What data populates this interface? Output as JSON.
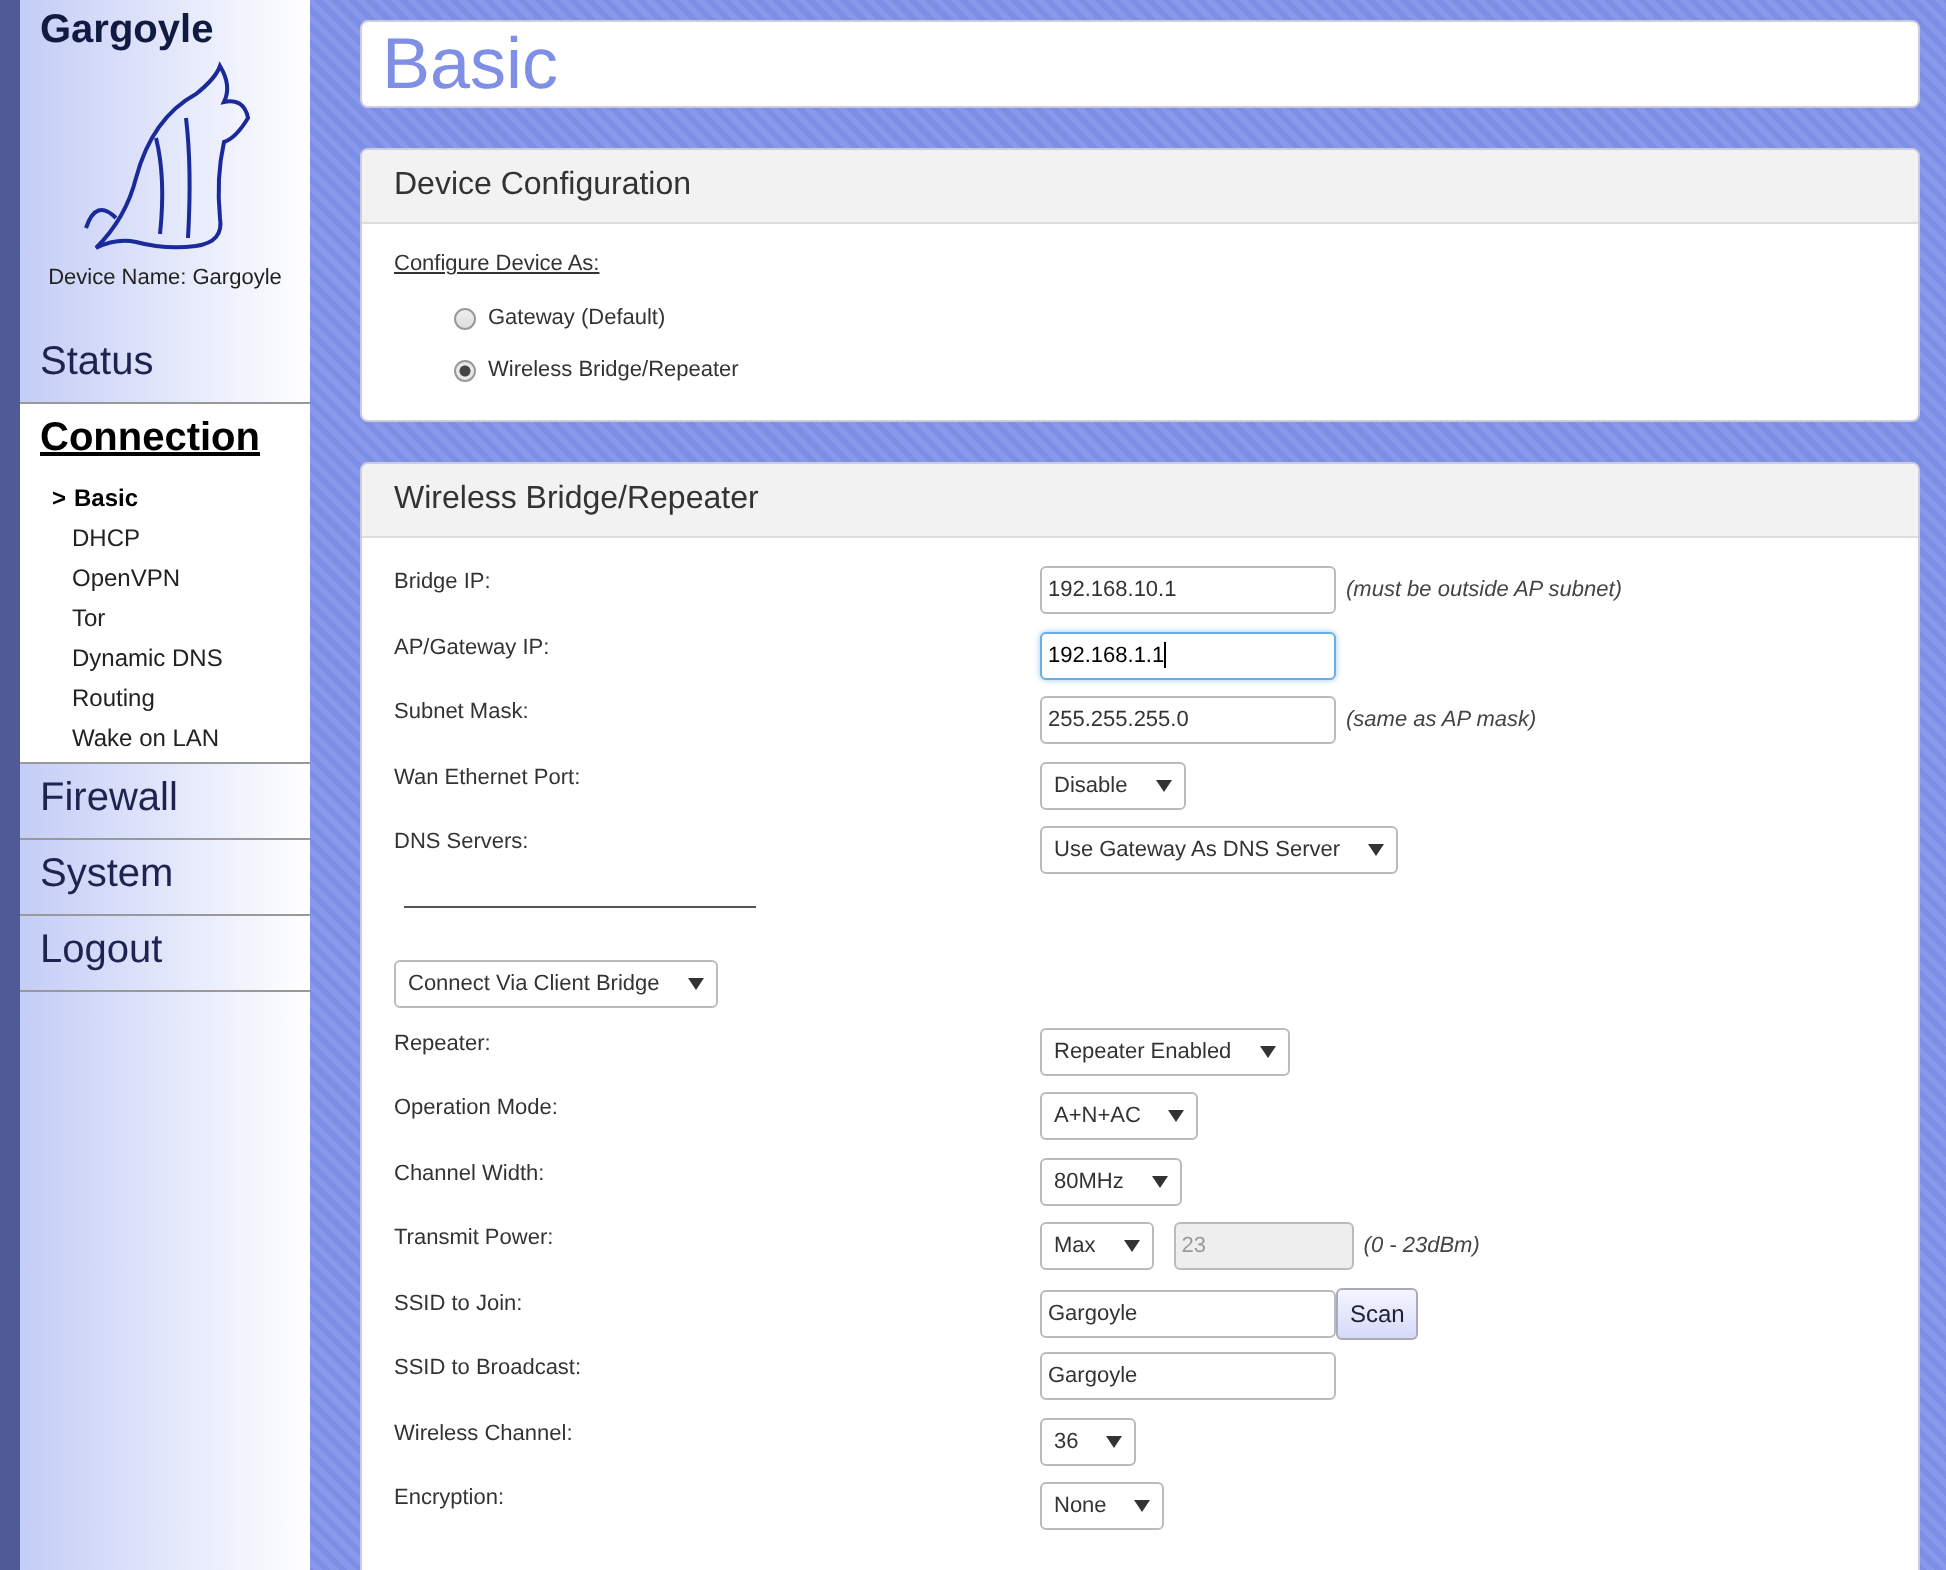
{
  "sidebar": {
    "title": "Gargoyle",
    "device_name": "Device Name: Gargoyle",
    "selected_marker": ">",
    "nav": [
      {
        "label": "Status",
        "selected": false
      },
      {
        "label": "Connection",
        "selected": true,
        "children": [
          {
            "label": "Basic",
            "selected": true
          },
          {
            "label": "DHCP",
            "selected": false
          },
          {
            "label": "OpenVPN",
            "selected": false
          },
          {
            "label": "Tor",
            "selected": false
          },
          {
            "label": "Dynamic DNS",
            "selected": false
          },
          {
            "label": "Routing",
            "selected": false
          },
          {
            "label": "Wake on LAN",
            "selected": false
          }
        ]
      },
      {
        "label": "Firewall",
        "selected": false
      },
      {
        "label": "System",
        "selected": false
      },
      {
        "label": "Logout",
        "selected": false
      }
    ]
  },
  "page_title": "Basic",
  "device_configuration": {
    "title": "Device Configuration",
    "label": "Configure Device As:",
    "options": [
      {
        "label": "Gateway (Default)",
        "selected": false
      },
      {
        "label": "Wireless Bridge/Repeater",
        "selected": true
      }
    ]
  },
  "bridge_section": {
    "title": "Wireless Bridge/Repeater",
    "rows": [
      {
        "kind": "field",
        "label": "Bridge IP:",
        "controls": [
          {
            "kind": "input",
            "value": "192.168.10.1",
            "focused": false,
            "disabled": false
          }
        ],
        "note": "(must be outside AP subnet)"
      },
      {
        "kind": "field",
        "label": "AP/Gateway IP:",
        "controls": [
          {
            "kind": "input",
            "value": "192.168.1.1",
            "focused": true,
            "disabled": false
          }
        ]
      },
      {
        "kind": "field",
        "label": "Subnet Mask:",
        "controls": [
          {
            "kind": "input",
            "value": "255.255.255.0",
            "focused": false,
            "disabled": false
          }
        ],
        "note": "(same as AP mask)"
      },
      {
        "kind": "field",
        "label": "Wan Ethernet Port:",
        "controls": [
          {
            "kind": "select",
            "value": "Disable"
          }
        ]
      },
      {
        "kind": "field",
        "label": "DNS Servers:",
        "controls": [
          {
            "kind": "select",
            "value": "Use Gateway As DNS Server"
          }
        ]
      },
      {
        "kind": "divider"
      },
      {
        "kind": "mode",
        "controls": [
          {
            "kind": "select",
            "value": "Connect Via Client Bridge"
          }
        ]
      },
      {
        "kind": "field",
        "label": "Repeater:",
        "controls": [
          {
            "kind": "select",
            "value": "Repeater Enabled"
          }
        ]
      },
      {
        "kind": "field",
        "label": "Operation Mode:",
        "controls": [
          {
            "kind": "select",
            "value": "A+N+AC"
          }
        ]
      },
      {
        "kind": "field",
        "label": "Channel Width:",
        "controls": [
          {
            "kind": "select",
            "value": "80MHz"
          }
        ]
      },
      {
        "kind": "field",
        "label": "Transmit Power:",
        "controls": [
          {
            "kind": "select",
            "value": "Max"
          },
          {
            "kind": "input",
            "value": "23",
            "focused": false,
            "disabled": true
          }
        ],
        "note": "(0 - 23dBm)"
      },
      {
        "kind": "field",
        "label": "SSID to Join:",
        "controls": [
          {
            "kind": "input",
            "value": "Gargoyle",
            "focused": false,
            "disabled": false
          },
          {
            "kind": "button",
            "value": "Scan"
          }
        ]
      },
      {
        "kind": "field",
        "label": "SSID to Broadcast:",
        "controls": [
          {
            "kind": "input",
            "value": "Gargoyle",
            "focused": false,
            "disabled": false
          }
        ]
      },
      {
        "kind": "field",
        "label": "Wireless Channel:",
        "controls": [
          {
            "kind": "select",
            "value": "36"
          }
        ]
      },
      {
        "kind": "field",
        "label": "Encryption:",
        "controls": [
          {
            "kind": "select",
            "value": "None"
          }
        ]
      }
    ]
  }
}
